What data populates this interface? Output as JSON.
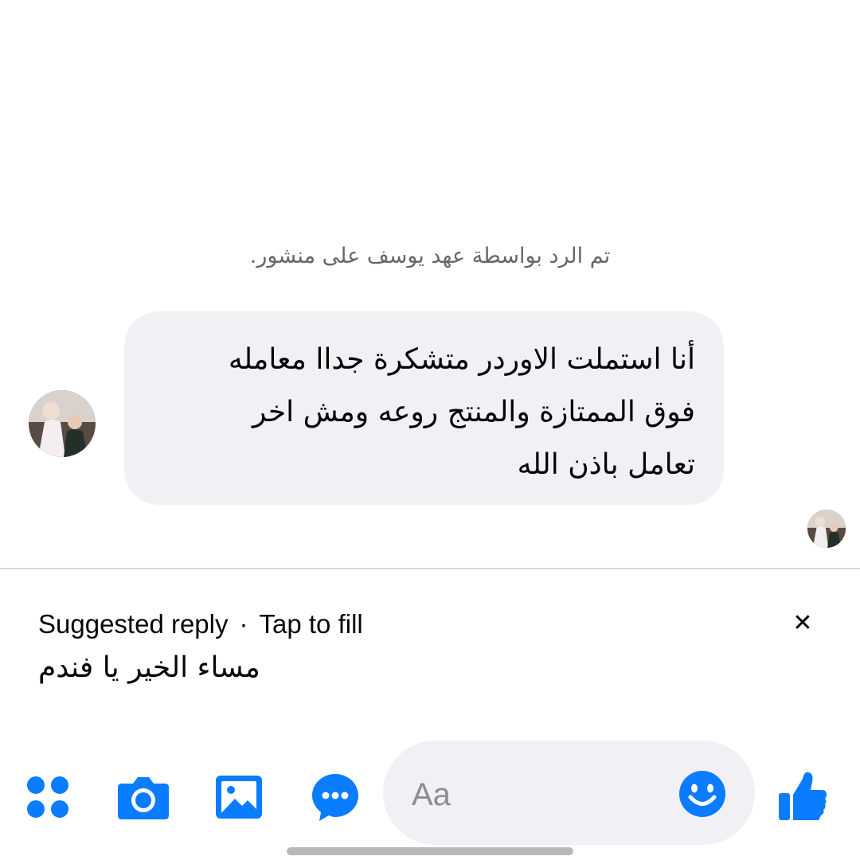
{
  "conversation": {
    "reply_note": "تم الرد بواسطة عهد يوسف على منشور.",
    "message": {
      "text": "أنا استملت الاوردر  متشكرة جداا معامله\nفوق الممتازة والمنتج روعه ومش اخر\nتعامل باذن الله"
    }
  },
  "suggestion": {
    "label": "Suggested reply",
    "separator": "·",
    "hint": "Tap to fill",
    "text": "مساء الخير يا فندم",
    "close_symbol": "✕"
  },
  "composer": {
    "placeholder": "Aa"
  },
  "icons": {
    "menu": "four-dots-icon",
    "camera": "camera-icon",
    "gallery": "image-icon",
    "chat": "chat-bubble-icon",
    "emoji": "emoji-icon",
    "like": "thumbs-up-icon"
  },
  "colors": {
    "accent": "#0a7cff",
    "bubble": "#f0f0f5",
    "meta_text": "#65676b"
  }
}
